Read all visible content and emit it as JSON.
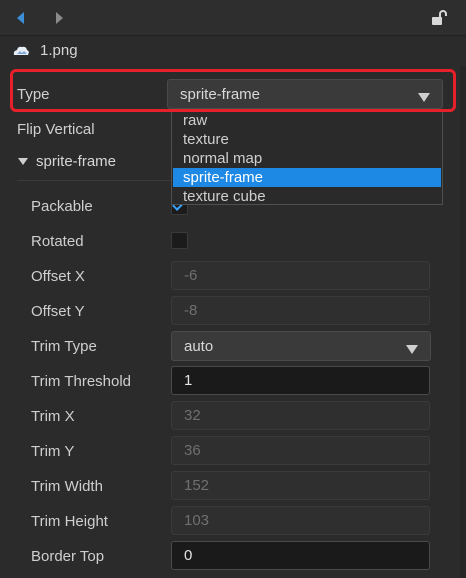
{
  "file": {
    "name": "1.png",
    "icon": "image-file-icon"
  },
  "toolbar": {
    "back": "arrow-left-icon",
    "forward": "arrow-right-icon",
    "lock": "unlock-icon"
  },
  "colors": {
    "accent": "#1e88e5",
    "highlight_border": "#e8202a",
    "check": "#3aa3ff"
  },
  "type": {
    "label": "Type",
    "value": "sprite-frame",
    "options": [
      "raw",
      "texture",
      "normal map",
      "sprite-frame",
      "texture cube"
    ],
    "selected_index": 3
  },
  "flip_vertical": {
    "label": "Flip Vertical"
  },
  "section": {
    "title": "sprite-frame",
    "packable": {
      "label": "Packable",
      "checked": true
    },
    "rotated": {
      "label": "Rotated",
      "checked": false
    },
    "offset_x": {
      "label": "Offset X",
      "value": "-6"
    },
    "offset_y": {
      "label": "Offset Y",
      "value": "-8"
    },
    "trim_type": {
      "label": "Trim Type",
      "value": "auto"
    },
    "trim_threshold": {
      "label": "Trim Threshold",
      "value": "1"
    },
    "trim_x": {
      "label": "Trim X",
      "value": "32"
    },
    "trim_y": {
      "label": "Trim Y",
      "value": "36"
    },
    "trim_width": {
      "label": "Trim Width",
      "value": "152"
    },
    "trim_height": {
      "label": "Trim Height",
      "value": "103"
    },
    "border_top": {
      "label": "Border Top",
      "value": "0"
    }
  }
}
